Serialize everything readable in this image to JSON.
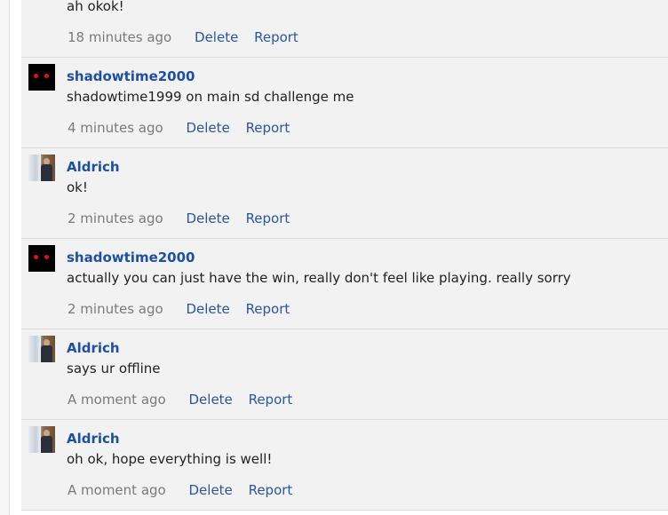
{
  "comments": [
    {
      "author": "",
      "avatar": "aldrich",
      "text": "ah okok!",
      "time": "18 minutes ago",
      "delete_label": "Delete",
      "report_label": "Report"
    },
    {
      "author": "shadowtime2000",
      "avatar": "shadow",
      "text": "shadowtime1999 on main sd challenge me",
      "time": "4 minutes ago",
      "delete_label": "Delete",
      "report_label": "Report"
    },
    {
      "author": "Aldrich",
      "avatar": "aldrich",
      "text": "ok!",
      "time": "2 minutes ago",
      "delete_label": "Delete",
      "report_label": "Report"
    },
    {
      "author": "shadowtime2000",
      "avatar": "shadow",
      "text": "actually you can just have the win, really don't feel like playing. really sorry",
      "time": "2 minutes ago",
      "delete_label": "Delete",
      "report_label": "Report"
    },
    {
      "author": "Aldrich",
      "avatar": "aldrich",
      "text": "says ur offline",
      "time": "A moment ago",
      "delete_label": "Delete",
      "report_label": "Report"
    },
    {
      "author": "Aldrich",
      "avatar": "aldrich",
      "text": "oh ok, hope everything is well!",
      "time": "A moment ago",
      "delete_label": "Delete",
      "report_label": "Report"
    }
  ]
}
